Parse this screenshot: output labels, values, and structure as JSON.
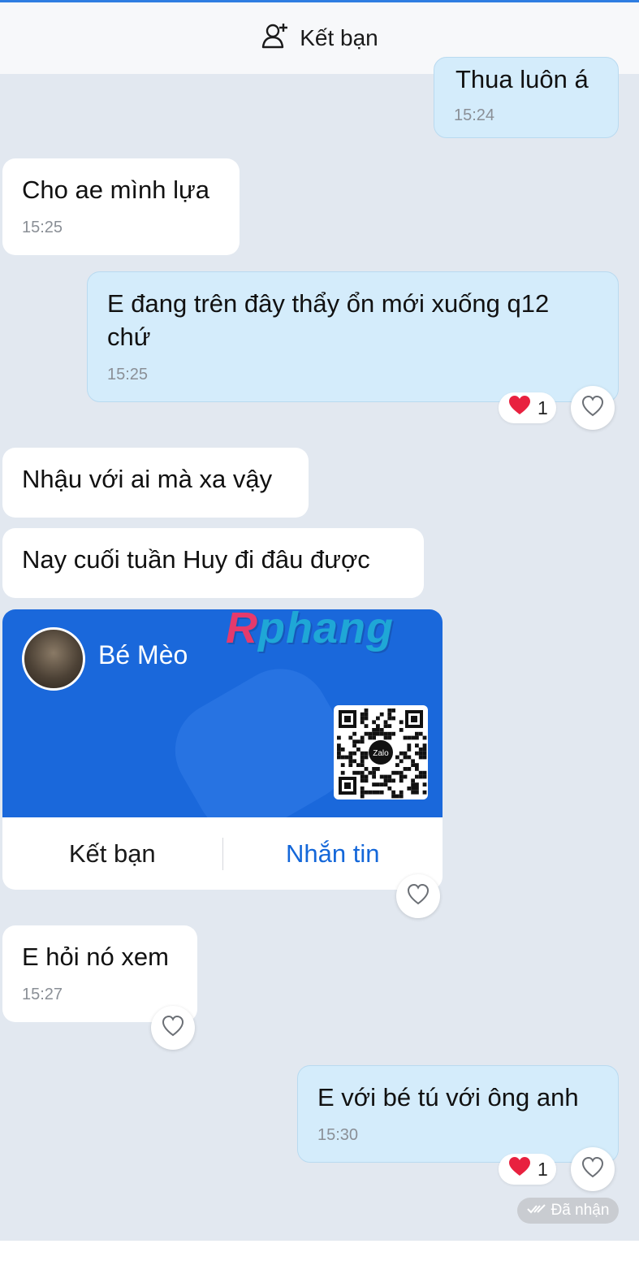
{
  "header": {
    "add_friend_label": "Kết bạn",
    "icon": "add-user-icon"
  },
  "messages": [
    {
      "text": "Thua luôn á",
      "time": "15:24",
      "direction": "out"
    },
    {
      "text": "Cho ae mình lựa",
      "time": "15:25",
      "direction": "in"
    },
    {
      "text": "E đang trên đây thẩy ổn mới xuống q12 chứ",
      "time": "15:25",
      "direction": "out",
      "reaction_count": "1"
    },
    {
      "text": "Nhậu với ai mà xa vậy",
      "direction": "in"
    },
    {
      "text": "Nay cuối tuần Huy đi đâu được",
      "direction": "in"
    },
    {
      "text": "E hỏi nó xem",
      "time": "15:27",
      "direction": "in"
    },
    {
      "text": "E với bé tú với ông anh",
      "time": "15:30",
      "direction": "out",
      "reaction_count": "1"
    }
  ],
  "contact_card": {
    "name": "Bé Mèo",
    "qr_label": "Zalo",
    "add_friend_label": "Kết bạn",
    "message_label": "Nhắn tin"
  },
  "watermark": {
    "first": "R",
    "rest": "phang"
  },
  "status": {
    "text": "Đã nhận",
    "icon": "double-check-icon"
  },
  "colors": {
    "background": "#e2e8f0",
    "outgoing_bubble": "#d4ecfb",
    "incoming_bubble": "#ffffff",
    "card_blue": "#1a68db",
    "accent": "#1467d9",
    "reaction_heart": "#e8213f"
  }
}
